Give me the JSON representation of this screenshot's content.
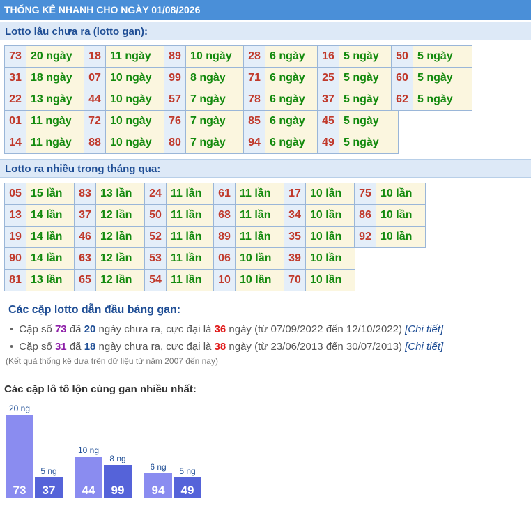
{
  "title": "THỐNG KÊ NHANH CHO NGÀY 01/08/2026",
  "gan_section": {
    "heading": "Lotto lâu chưa ra (lotto gan):",
    "groups": [
      [
        {
          "n": "73",
          "v": "20 ngày"
        },
        {
          "n": "31",
          "v": "18 ngày"
        },
        {
          "n": "22",
          "v": "13 ngày"
        },
        {
          "n": "01",
          "v": "11 ngày"
        },
        {
          "n": "14",
          "v": "11 ngày"
        }
      ],
      [
        {
          "n": "18",
          "v": "11 ngày"
        },
        {
          "n": "07",
          "v": "10 ngày"
        },
        {
          "n": "44",
          "v": "10 ngày"
        },
        {
          "n": "72",
          "v": "10 ngày"
        },
        {
          "n": "88",
          "v": "10 ngày"
        }
      ],
      [
        {
          "n": "89",
          "v": "10 ngày"
        },
        {
          "n": "99",
          "v": "8 ngày"
        },
        {
          "n": "57",
          "v": "7 ngày"
        },
        {
          "n": "76",
          "v": "7 ngày"
        },
        {
          "n": "80",
          "v": "7 ngày"
        }
      ],
      [
        {
          "n": "28",
          "v": "6 ngày"
        },
        {
          "n": "71",
          "v": "6 ngày"
        },
        {
          "n": "78",
          "v": "6 ngày"
        },
        {
          "n": "85",
          "v": "6 ngày"
        },
        {
          "n": "94",
          "v": "6 ngày"
        }
      ],
      [
        {
          "n": "16",
          "v": "5 ngày"
        },
        {
          "n": "25",
          "v": "5 ngày"
        },
        {
          "n": "37",
          "v": "5 ngày"
        },
        {
          "n": "45",
          "v": "5 ngày"
        },
        {
          "n": "49",
          "v": "5 ngày"
        }
      ],
      [
        {
          "n": "50",
          "v": "5 ngày"
        },
        {
          "n": "60",
          "v": "5 ngày"
        },
        {
          "n": "62",
          "v": "5 ngày"
        }
      ]
    ]
  },
  "nhieu_section": {
    "heading": "Lotto ra nhiều trong tháng qua:",
    "groups": [
      [
        {
          "n": "05",
          "v": "15 lần"
        },
        {
          "n": "13",
          "v": "14 lần"
        },
        {
          "n": "19",
          "v": "14 lần"
        },
        {
          "n": "90",
          "v": "14 lần"
        },
        {
          "n": "81",
          "v": "13 lần"
        }
      ],
      [
        {
          "n": "83",
          "v": "13 lần"
        },
        {
          "n": "37",
          "v": "12 lần"
        },
        {
          "n": "46",
          "v": "12 lần"
        },
        {
          "n": "63",
          "v": "12 lần"
        },
        {
          "n": "65",
          "v": "12 lần"
        }
      ],
      [
        {
          "n": "24",
          "v": "11 lần"
        },
        {
          "n": "50",
          "v": "11 lần"
        },
        {
          "n": "52",
          "v": "11 lần"
        },
        {
          "n": "53",
          "v": "11 lần"
        },
        {
          "n": "54",
          "v": "11 lần"
        }
      ],
      [
        {
          "n": "61",
          "v": "11 lần"
        },
        {
          "n": "68",
          "v": "11 lần"
        },
        {
          "n": "89",
          "v": "11 lần"
        },
        {
          "n": "06",
          "v": "10 lần"
        },
        {
          "n": "10",
          "v": "10 lần"
        }
      ],
      [
        {
          "n": "17",
          "v": "10 lần"
        },
        {
          "n": "34",
          "v": "10 lần"
        },
        {
          "n": "35",
          "v": "10 lần"
        },
        {
          "n": "39",
          "v": "10 lần"
        },
        {
          "n": "70",
          "v": "10 lần"
        }
      ],
      [
        {
          "n": "75",
          "v": "10 lần"
        },
        {
          "n": "86",
          "v": "10 lần"
        },
        {
          "n": "92",
          "v": "10 lần"
        }
      ]
    ]
  },
  "lead": {
    "title": "Các cặp lotto dẫn đầu bảng gan:",
    "items": [
      {
        "pre": "Cặp số ",
        "pair": "73",
        "mid1": " đã ",
        "days": "20",
        "mid2": " ngày chưa ra, cực đại là ",
        "max": "36",
        "mid3": " ngày (từ 07/09/2022 đến 12/10/2022) ",
        "link": "[Chi tiết]"
      },
      {
        "pre": "Cặp số ",
        "pair": "31",
        "mid1": " đã ",
        "days": "18",
        "mid2": " ngày chưa ra, cực đại là ",
        "max": "38",
        "mid3": " ngày (từ 23/06/2013 đến 30/07/2013) ",
        "link": "[Chi tiết]"
      }
    ],
    "bullet": "•",
    "note": "(Kết quả thống kê dựa trên dữ liệu từ năm 2007 đến nay)"
  },
  "chart_data": {
    "type": "bar",
    "title": "Các cặp lô tô lộn cùng gan nhiều nhất:",
    "unit": "ng",
    "categories": [
      "73",
      "37",
      "44",
      "99",
      "94",
      "49"
    ],
    "values": [
      20,
      5,
      10,
      8,
      6,
      5
    ],
    "groups": [
      [
        "73",
        "37"
      ],
      [
        "44",
        "99"
      ],
      [
        "94",
        "49"
      ]
    ],
    "colors": {
      "first": "#8a8cf0",
      "second": "#5563d9",
      "label": "#1f4e95"
    }
  }
}
